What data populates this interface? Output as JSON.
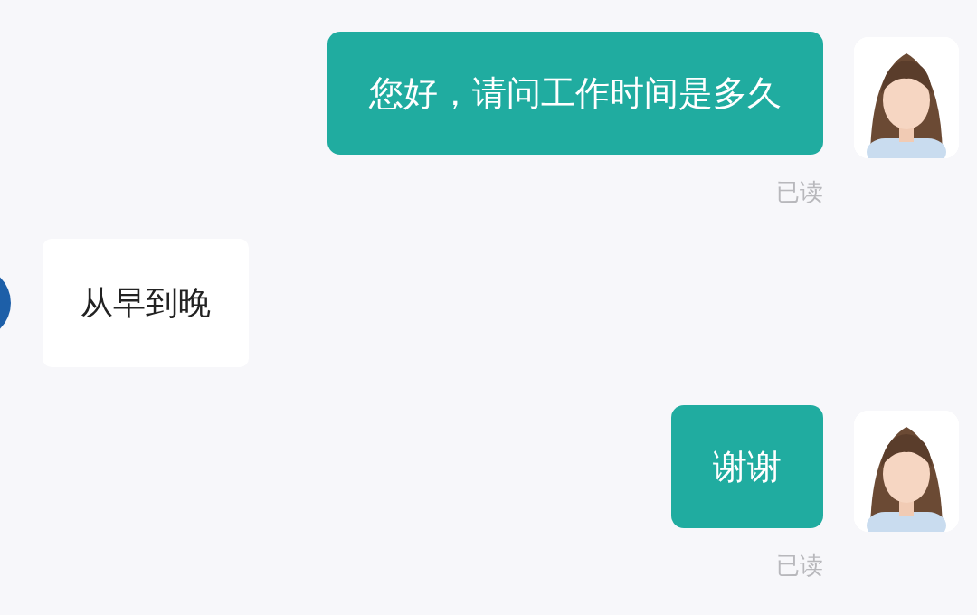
{
  "messages": [
    {
      "kind": "sent",
      "text": "您好，请问工作时间是多久",
      "status": "已读"
    },
    {
      "kind": "received",
      "text": "从早到晚"
    },
    {
      "kind": "sent",
      "text": "谢谢",
      "status": "已读"
    }
  ]
}
